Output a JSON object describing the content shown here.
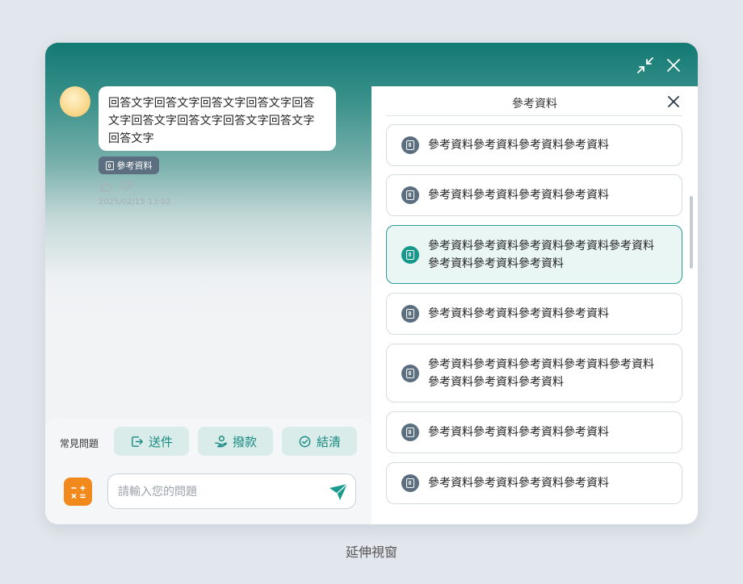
{
  "window": {
    "minimize_icon": "collapse-arrows-icon",
    "close_icon": "close-icon"
  },
  "chat": {
    "message_lines": [
      "回答文字回答文字回答文字回答文字回答",
      "文字回答文字回答文字回答文字回答文字",
      "回答文字"
    ],
    "reference_tag": "參考資料",
    "timestamp": "2025/02/15 13:02"
  },
  "faq": {
    "label": "常見問題",
    "chips": [
      {
        "label": "送件",
        "icon": "send-document-icon"
      },
      {
        "label": "撥款",
        "icon": "hand-money-icon"
      },
      {
        "label": "結清",
        "icon": "check-circle-icon"
      }
    ]
  },
  "input": {
    "placeholder": "請輸入您的問題",
    "value": ""
  },
  "panel": {
    "title": "參考資料",
    "items": [
      {
        "lines": [
          "參考資料參考資料參考資料參考資料"
        ],
        "selected": false
      },
      {
        "lines": [
          "參考資料參考資料參考資料參考資料"
        ],
        "selected": false
      },
      {
        "lines": [
          "參考資料參考資料參考資料參考資料參考資料",
          "參考資料參考資料參考資料"
        ],
        "selected": true
      },
      {
        "lines": [
          "參考資料參考資料參考資料參考資料"
        ],
        "selected": false
      },
      {
        "lines": [
          "參考資料參考資料參考資料參考資料參考資料",
          "參考資料參考資料參考資料"
        ],
        "selected": false
      },
      {
        "lines": [
          "參考資料參考資料參考資料參考資料"
        ],
        "selected": false
      },
      {
        "lines": [
          "參考資料參考資料參考資料參考資料"
        ],
        "selected": false
      }
    ]
  },
  "colors": {
    "brand": "#127a73",
    "accent": "#16988d",
    "faq_chip_bg": "#d9ece9",
    "calculator": "#f2891d",
    "tag_bg": "#5b6f80"
  },
  "caption": "延伸視窗"
}
